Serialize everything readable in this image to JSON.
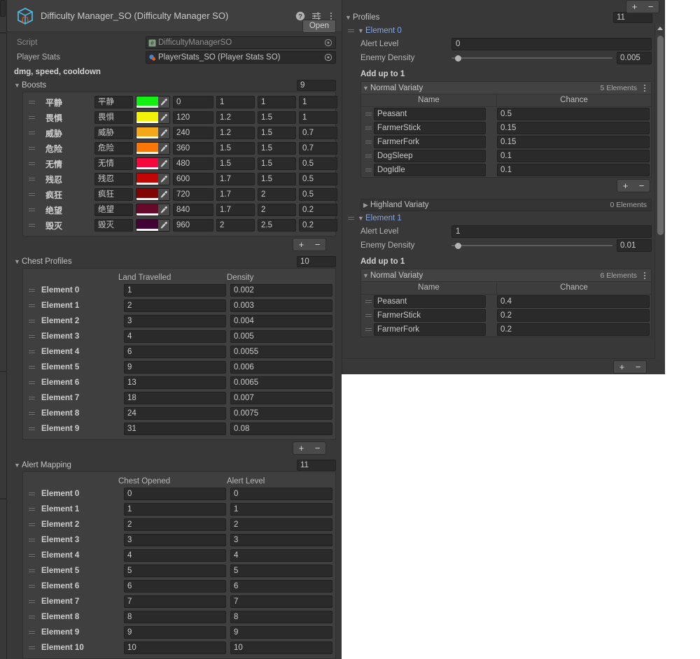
{
  "window": {
    "title": "Difficulty Manager_SO (Difficulty Manager SO)",
    "open_button": "Open",
    "icons": {
      "asset": "scriptable-object-icon",
      "help": "help-icon",
      "preset": "preset-icon",
      "menu": "kebab-menu-icon"
    }
  },
  "properties": {
    "script": {
      "label": "Script",
      "value": "DifficultyManagerSO"
    },
    "player_stats": {
      "label": "Player Stats",
      "value": "PlayerStats_SO (Player Stats SO)"
    }
  },
  "boosts": {
    "note": "dmg, speed, cooldown",
    "label": "Boosts",
    "size": "9",
    "rows": [
      {
        "name": "平静",
        "field": "平静",
        "color": "#12f012",
        "v1": "0",
        "v2": "1",
        "v3": "1",
        "v4": "1"
      },
      {
        "name": "畏惧",
        "field": "畏惧",
        "color": "#f2f209",
        "v1": "120",
        "v2": "1.2",
        "v3": "1.5",
        "v4": "1"
      },
      {
        "name": "威胁",
        "field": "威胁",
        "color": "#f5a71a",
        "v1": "240",
        "v2": "1.2",
        "v3": "1.5",
        "v4": "0.7"
      },
      {
        "name": "危险",
        "field": "危险",
        "color": "#f97608",
        "v1": "360",
        "v2": "1.5",
        "v3": "1.5",
        "v4": "0.7"
      },
      {
        "name": "无情",
        "field": "无情",
        "color": "#f7083c",
        "v1": "480",
        "v2": "1.5",
        "v3": "1.5",
        "v4": "0.5"
      },
      {
        "name": "残忍",
        "field": "残忍",
        "color": "#c20505",
        "v1": "600",
        "v2": "1.7",
        "v3": "1.5",
        "v4": "0.5"
      },
      {
        "name": "疯狂",
        "field": "疯狂",
        "color": "#800404",
        "v1": "720",
        "v2": "1.7",
        "v3": "2",
        "v4": "0.5"
      },
      {
        "name": "绝望",
        "field": "绝望",
        "color": "#66092b",
        "v1": "840",
        "v2": "1.7",
        "v3": "2",
        "v4": "0.2"
      },
      {
        "name": "毁灭",
        "field": "毁灭",
        "color": "#410434",
        "v1": "960",
        "v2": "2",
        "v3": "2.5",
        "v4": "0.2"
      }
    ],
    "add_label": "+",
    "remove_label": "−"
  },
  "chest_profiles": {
    "label": "Chest Profiles",
    "size": "10",
    "columns": [
      "Land Travelled",
      "Density"
    ],
    "rows": [
      {
        "element": "Element 0",
        "c1": "1",
        "c2": "0.002"
      },
      {
        "element": "Element 1",
        "c1": "2",
        "c2": "0.003"
      },
      {
        "element": "Element 2",
        "c1": "3",
        "c2": "0.004"
      },
      {
        "element": "Element 3",
        "c1": "4",
        "c2": "0.005"
      },
      {
        "element": "Element 4",
        "c1": "6",
        "c2": "0.0055"
      },
      {
        "element": "Element 5",
        "c1": "9",
        "c2": "0.006"
      },
      {
        "element": "Element 6",
        "c1": "13",
        "c2": "0.0065"
      },
      {
        "element": "Element 7",
        "c1": "18",
        "c2": "0.007"
      },
      {
        "element": "Element 8",
        "c1": "24",
        "c2": "0.0075"
      },
      {
        "element": "Element 9",
        "c1": "31",
        "c2": "0.08"
      }
    ]
  },
  "alert_mapping": {
    "label": "Alert Mapping",
    "size": "11",
    "columns": [
      "Chest Opened",
      "Alert Level"
    ],
    "rows": [
      {
        "element": "Element 0",
        "c1": "0",
        "c2": "0"
      },
      {
        "element": "Element 1",
        "c1": "1",
        "c2": "1"
      },
      {
        "element": "Element 2",
        "c1": "2",
        "c2": "2"
      },
      {
        "element": "Element 3",
        "c1": "3",
        "c2": "3"
      },
      {
        "element": "Element 4",
        "c1": "4",
        "c2": "4"
      },
      {
        "element": "Element 5",
        "c1": "5",
        "c2": "5"
      },
      {
        "element": "Element 6",
        "c1": "6",
        "c2": "6"
      },
      {
        "element": "Element 7",
        "c1": "7",
        "c2": "7"
      },
      {
        "element": "Element 8",
        "c1": "8",
        "c2": "8"
      },
      {
        "element": "Element 9",
        "c1": "9",
        "c2": "9"
      },
      {
        "element": "Element 10",
        "c1": "10",
        "c2": "10"
      }
    ]
  },
  "profiles": {
    "label": "Profiles",
    "size": "11",
    "add_label": "+",
    "remove_label": "−",
    "add_up_note": "Add up to 1",
    "alert_level_label": "Alert Level",
    "enemy_density_label": "Enemy Density",
    "variety_columns": [
      "Name",
      "Chance"
    ],
    "elements": [
      {
        "title": "Element 0",
        "alert_level": "0",
        "enemy_density": "0.005",
        "density_knob_pct": 2,
        "normal": {
          "label": "Normal Variaty",
          "count": "5 Elements",
          "rows": [
            {
              "name": "Peasant",
              "chance": "0.5"
            },
            {
              "name": "FarmerStick",
              "chance": "0.15"
            },
            {
              "name": "FarmerFork",
              "chance": "0.15"
            },
            {
              "name": "DogSleep",
              "chance": "0.1"
            },
            {
              "name": "DogIdle",
              "chance": "0.1"
            }
          ]
        },
        "highland": {
          "label": "Highland Variaty",
          "count": "0 Elements"
        }
      },
      {
        "title": "Element 1",
        "alert_level": "1",
        "enemy_density": "0.01",
        "density_knob_pct": 2,
        "normal": {
          "label": "Normal Variaty",
          "count": "6 Elements",
          "rows": [
            {
              "name": "Peasant",
              "chance": "0.4"
            },
            {
              "name": "FarmerStick",
              "chance": "0.2"
            },
            {
              "name": "FarmerFork",
              "chance": "0.2"
            }
          ]
        }
      }
    ]
  }
}
